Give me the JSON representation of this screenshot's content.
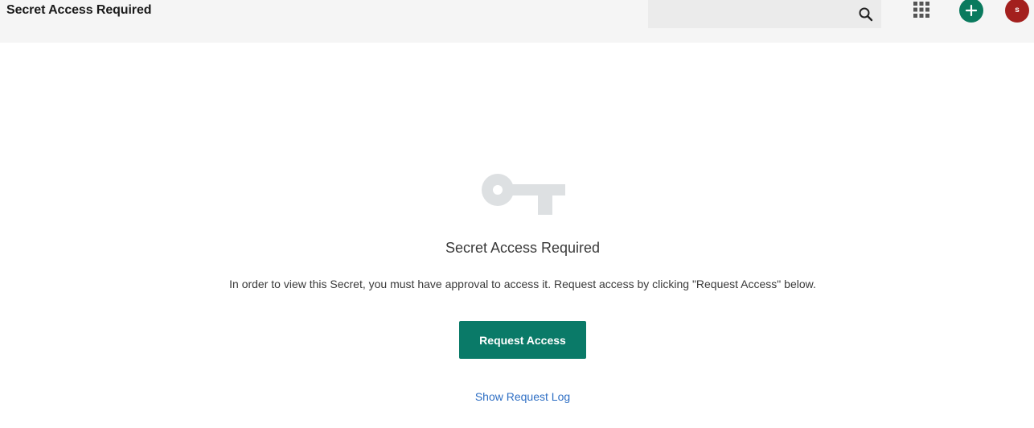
{
  "header": {
    "title": "Secret Access Required",
    "search": {
      "value": "",
      "placeholder": ""
    },
    "search_icon": "search-icon",
    "apps_icon": "apps-grid-icon",
    "add_icon": "plus-icon",
    "avatar_initial": "s",
    "colors": {
      "bar": "#f5f5f5",
      "add": "#0a7a5e",
      "avatar": "#a3201e"
    }
  },
  "main": {
    "icon": "key-icon",
    "heading": "Secret Access Required",
    "description": "In order to view this Secret, you must have approval to access it. Request access by clicking \"Request Access\" below.",
    "request_button_label": "Request Access",
    "request_log_link": "Show Request Log",
    "colors": {
      "button": "#0a7a68",
      "link": "#2f6fc4",
      "icon": "#dde0e2"
    }
  }
}
